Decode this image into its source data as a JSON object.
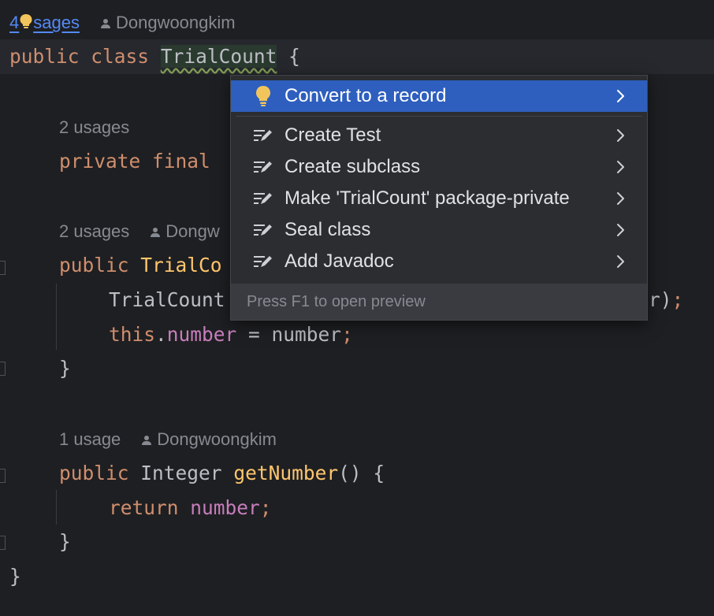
{
  "editor": {
    "class_usages": {
      "count": "4",
      "suffix": "sages",
      "author": "Dongwoongkim"
    },
    "class_decl": {
      "kw_public": "public",
      "kw_class": "class",
      "class_name": "TrialCount",
      "brace": "{"
    },
    "field_hint": {
      "usages": "2 usages"
    },
    "field_line": {
      "kw_private": "private",
      "kw_final": "final"
    },
    "ctor_hint": {
      "usages": "2 usages",
      "author": "Dongw"
    },
    "ctor_line": {
      "kw_public": "public",
      "name": "TrialCo"
    },
    "ctor_body_line1": {
      "text": "TrialCount",
      "tail": "r)",
      "semi": ";"
    },
    "ctor_body_line2": {
      "kw_this": "this",
      "dot": ".",
      "field": "number",
      "assign": " = number",
      "semi": ";"
    },
    "ctor_close": "}",
    "getter_hint": {
      "usages": "1 usage",
      "author": "Dongwoongkim"
    },
    "getter_line": {
      "kw_public": "public",
      "type": "Integer",
      "method": "getNumber",
      "rest": "() {"
    },
    "getter_body": {
      "kw_return": "return",
      "field": "number",
      "semi": ";"
    },
    "getter_close": "}",
    "class_close": "}"
  },
  "popup": {
    "items": [
      {
        "label": "Convert to a record",
        "icon": "bulb-icon",
        "selected": true
      },
      {
        "label": "Create Test",
        "icon": "edit-intention-icon"
      },
      {
        "label": "Create subclass",
        "icon": "edit-intention-icon"
      },
      {
        "label": "Make 'TrialCount' package-private",
        "icon": "edit-intention-icon"
      },
      {
        "label": "Seal class",
        "icon": "edit-intention-icon"
      },
      {
        "label": "Add Javadoc",
        "icon": "edit-intention-icon"
      }
    ],
    "footer": "Press F1 to open preview"
  },
  "colors": {
    "background": "#1e1f22",
    "keyword": "#cf8e6d",
    "field": "#c77dbb",
    "method": "#56a8f5",
    "selection": "#2e5fbe",
    "link": "#548af7",
    "bulb": "#f2c55c"
  }
}
